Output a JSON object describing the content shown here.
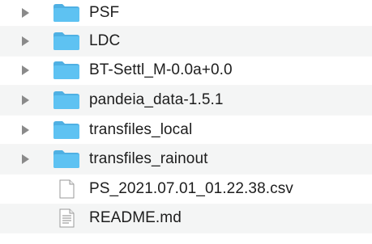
{
  "file_list": {
    "items": [
      {
        "name": "PSF",
        "kind": "folder",
        "icon": "folder-icon",
        "expandable": true
      },
      {
        "name": "LDC",
        "kind": "folder",
        "icon": "folder-icon",
        "expandable": true
      },
      {
        "name": "BT-Settl_M-0.0a+0.0",
        "kind": "folder",
        "icon": "folder-icon",
        "expandable": true
      },
      {
        "name": "pandeia_data-1.5.1",
        "kind": "folder",
        "icon": "folder-icon",
        "expandable": true
      },
      {
        "name": "transfiles_local",
        "kind": "folder",
        "icon": "folder-icon",
        "expandable": true
      },
      {
        "name": "transfiles_rainout",
        "kind": "folder",
        "icon": "folder-icon",
        "expandable": true
      },
      {
        "name": "PS_2021.07.01_01.22.38.csv",
        "kind": "file",
        "icon": "csv-file-icon",
        "expandable": false
      },
      {
        "name": "README.md",
        "kind": "file",
        "icon": "text-file-icon",
        "expandable": false
      }
    ]
  },
  "colors": {
    "folder_front": "#5ec2f2",
    "folder_back": "#4fb0e3",
    "disclosure": "#8a8a8a",
    "row_alt": "#f4f5f5",
    "text": "#1d1d1d"
  }
}
